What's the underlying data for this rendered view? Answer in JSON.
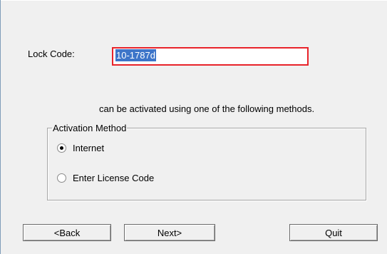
{
  "lock": {
    "label": "Lock Code:",
    "value": "10-1787d"
  },
  "activation_text": "can be activated using one of the following methods.",
  "activation_method": {
    "legend": "Activation Method",
    "options": [
      {
        "label": "Internet",
        "selected": true
      },
      {
        "label": "Enter License Code",
        "selected": false
      }
    ]
  },
  "buttons": {
    "back": "<Back",
    "next": "Next>",
    "quit": "Quit"
  },
  "colors": {
    "highlight_border": "#e8232a",
    "selection": "#3d75c9"
  }
}
